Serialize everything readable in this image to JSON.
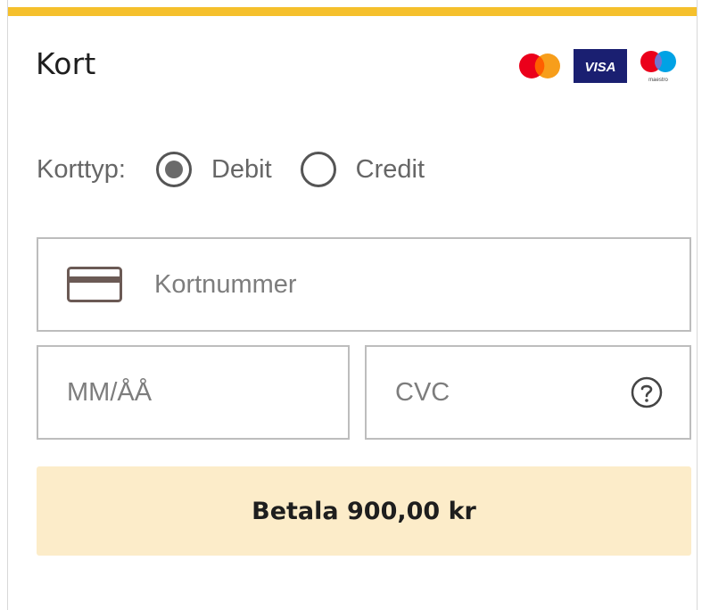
{
  "section": {
    "title": "Kort"
  },
  "card_brands": [
    "mastercard-logo",
    "visa-logo",
    "maestro-logo"
  ],
  "visa_text": "VISA",
  "maestro_text": "maestro",
  "card_type": {
    "label": "Korttyp:",
    "options": [
      {
        "label": "Debit",
        "selected": true
      },
      {
        "label": "Credit",
        "selected": false
      }
    ]
  },
  "fields": {
    "card_number_placeholder": "Kortnummer",
    "expiry_placeholder": "MM/ÅÅ",
    "cvc_placeholder": "CVC"
  },
  "pay_button": {
    "label": "Betala 900,00 kr"
  },
  "colors": {
    "accent": "#f5c02c",
    "button_bg": "#fcecc9",
    "visa_blue": "#1a1f71",
    "mastercard_red": "#eb001b",
    "mastercard_orange": "#f79e1b",
    "maestro_blue": "#00a2e5"
  }
}
